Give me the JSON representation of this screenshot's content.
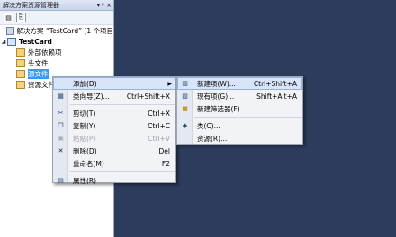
{
  "panel": {
    "title": "解决方案资源管理器",
    "pin": "▾",
    "pin2": "ᵖ",
    "close": "×"
  },
  "tree": {
    "solution": "解决方案 “TestCard” (1 个项目",
    "project": "TestCard",
    "items": [
      "外部依赖项",
      "头文件",
      "源文件",
      "资源文件"
    ]
  },
  "context_menu": {
    "items": [
      {
        "label": "添加(D)",
        "shortcut": "",
        "submenu": true
      },
      {
        "label": "类向导(Z)...",
        "shortcut": "Ctrl+Shift+X"
      },
      {
        "label": "剪切(T)",
        "shortcut": "Ctrl+X"
      },
      {
        "label": "复制(Y)",
        "shortcut": "Ctrl+C"
      },
      {
        "label": "粘贴(P)",
        "shortcut": "Ctrl+V"
      },
      {
        "label": "删除(D)",
        "shortcut": "Del"
      },
      {
        "label": "重命名(M)",
        "shortcut": "F2"
      },
      {
        "label": "属性(R)",
        "shortcut": ""
      }
    ]
  },
  "submenu": {
    "items": [
      {
        "label": "新建项(W)...",
        "shortcut": "Ctrl+Shift+A"
      },
      {
        "label": "现有项(G)...",
        "shortcut": "Shift+Alt+A"
      },
      {
        "label": "新建筛选器(F)",
        "shortcut": ""
      },
      {
        "label": "类(C)...",
        "shortcut": ""
      },
      {
        "label": "资源(R)...",
        "shortcut": ""
      }
    ]
  }
}
